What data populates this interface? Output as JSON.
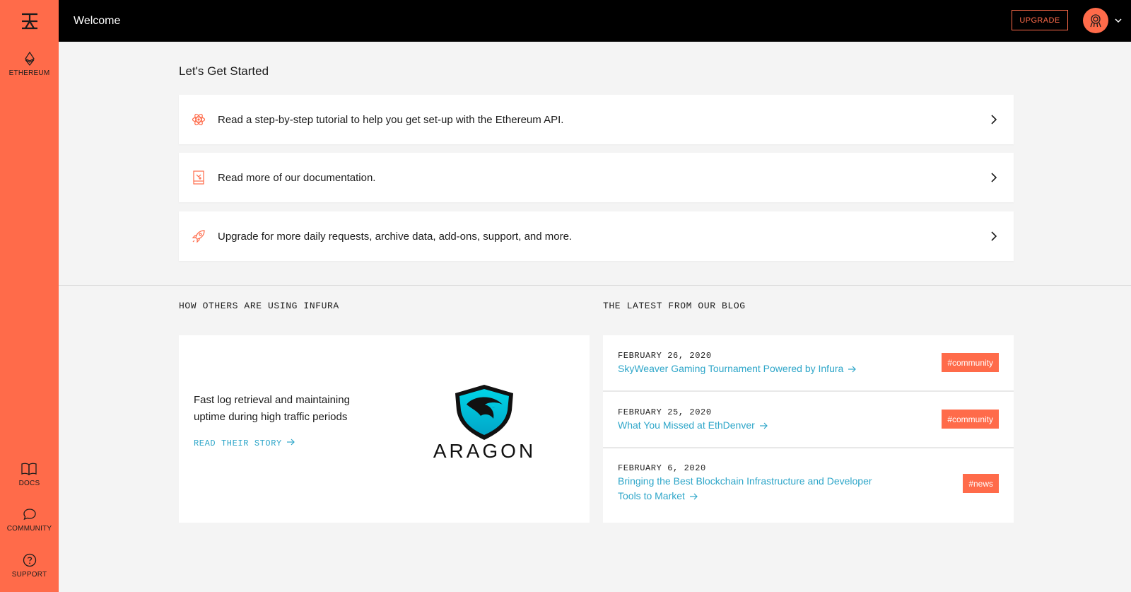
{
  "colors": {
    "accent": "#ff6b4a",
    "topbar": "#000000",
    "link": "#2ea6c9",
    "background": "#f4f4f4"
  },
  "sidebar": {
    "logo_icon": "infura-logo-icon",
    "top_items": [
      {
        "label": "ETHEREUM",
        "icon": "ethereum-icon"
      }
    ],
    "bottom_items": [
      {
        "label": "DOCS",
        "icon": "book-icon"
      },
      {
        "label": "COMMUNITY",
        "icon": "chat-bubble-icon"
      },
      {
        "label": "SUPPORT",
        "icon": "question-circle-icon"
      }
    ]
  },
  "header": {
    "title": "Welcome",
    "upgrade_label": "UPGRADE",
    "avatar_icon": "user-avatar-icon",
    "caret_icon": "chevron-down-icon"
  },
  "get_started": {
    "title": "Let's Get Started",
    "items": [
      {
        "text": "Read a step-by-step tutorial to help you get set-up with the Ethereum API.",
        "icon": "atom-icon"
      },
      {
        "text": "Read more of our documentation.",
        "icon": "document-icon"
      },
      {
        "text": "Upgrade for more daily requests, archive data, add-ons, support, and more.",
        "icon": "rocket-icon"
      }
    ]
  },
  "showcase": {
    "title": "HOW OTHERS ARE USING INFURA",
    "text": "Fast log retrieval and maintaining uptime during high traffic periods",
    "link_label": "READ THEIR STORY",
    "logo_text": "ARAGON"
  },
  "blog": {
    "title": "THE LATEST FROM OUR BLOG",
    "posts": [
      {
        "date": "FEBRUARY 26, 2020",
        "title": "SkyWeaver Gaming Tournament Powered by Infura",
        "tag": "#community"
      },
      {
        "date": "FEBRUARY 25, 2020",
        "title": "What You Missed at EthDenver",
        "tag": "#community"
      },
      {
        "date": "FEBRUARY 6, 2020",
        "title": "Bringing the Best Blockchain Infrastructure and Developer Tools to Market",
        "tag": "#news"
      }
    ]
  }
}
